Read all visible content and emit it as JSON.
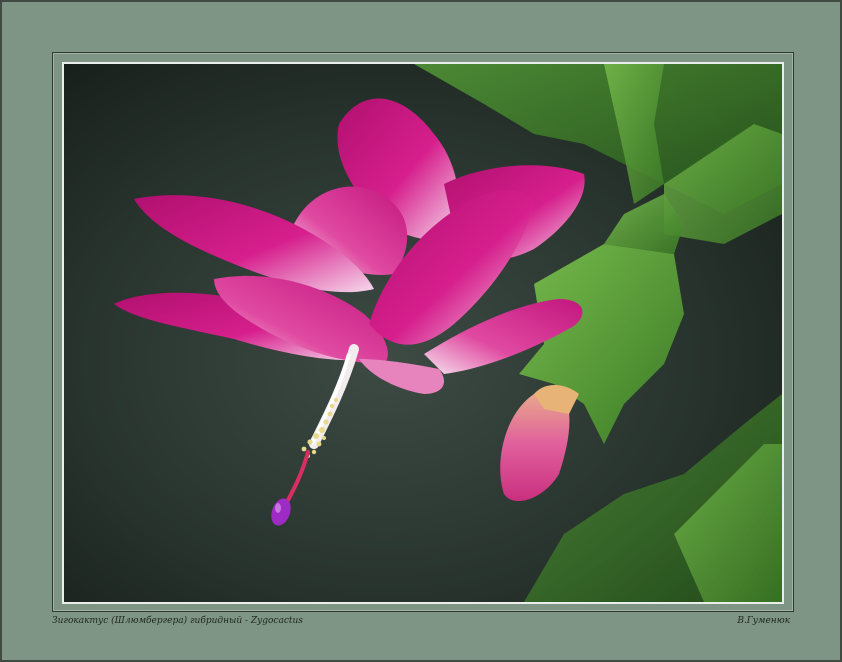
{
  "caption": {
    "title": "Зигокактус (Шлюмбергера) гибридный - Zygocactus",
    "author": "В.Гуменюк"
  },
  "photo": {
    "subject": "flowering-cactus-photo",
    "colors": {
      "background": "#2a352f",
      "petal": "#c8177f",
      "petal_light": "#f3d6ea",
      "leaf": "#5aa33a",
      "mat": "#7e9484"
    }
  }
}
